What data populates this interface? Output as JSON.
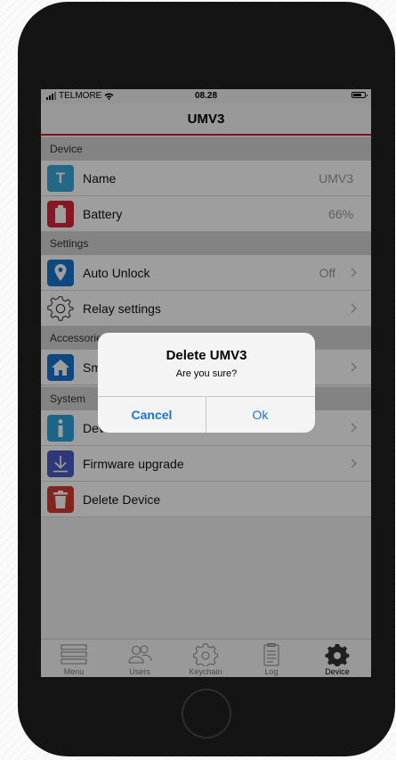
{
  "status_bar": {
    "carrier": "TELMORE",
    "time": "08.28"
  },
  "nav": {
    "title": "UMV3"
  },
  "sections": {
    "device": "Device",
    "settings": "Settings",
    "accessories": "Accessories",
    "system": "System"
  },
  "rows": {
    "name": {
      "label": "Name",
      "value": "UMV3",
      "icon_text": "T"
    },
    "battery": {
      "label": "Battery",
      "value": "66%"
    },
    "auto_unlock": {
      "label": "Auto Unlock",
      "value": "Off"
    },
    "relay": {
      "label": "Relay settings"
    },
    "smart": {
      "label": "Smart"
    },
    "device_info": {
      "label": "Device info"
    },
    "firmware": {
      "label": "Firmware upgrade"
    },
    "delete": {
      "label": "Delete Device"
    }
  },
  "tabs": [
    {
      "label": "Menu",
      "icon": "menu-icon"
    },
    {
      "label": "Users",
      "icon": "users-icon"
    },
    {
      "label": "Keychain",
      "icon": "keychain-icon"
    },
    {
      "label": "Log",
      "icon": "log-icon"
    },
    {
      "label": "Device",
      "icon": "gear-icon"
    }
  ],
  "alert": {
    "title": "Delete UMV3",
    "message": "Are you sure?",
    "cancel": "Cancel",
    "ok": "Ok"
  },
  "colors": {
    "accent_red": "#c9242b",
    "ios_blue": "#1a73d9",
    "name_icon": "#3aa7d9",
    "battery_icon": "#d9283a",
    "location_icon": "#1775d1",
    "home_icon": "#1775d1",
    "info_icon": "#2ea3db",
    "firmware_icon": "#4c5bc4",
    "delete_icon": "#d33b32"
  }
}
